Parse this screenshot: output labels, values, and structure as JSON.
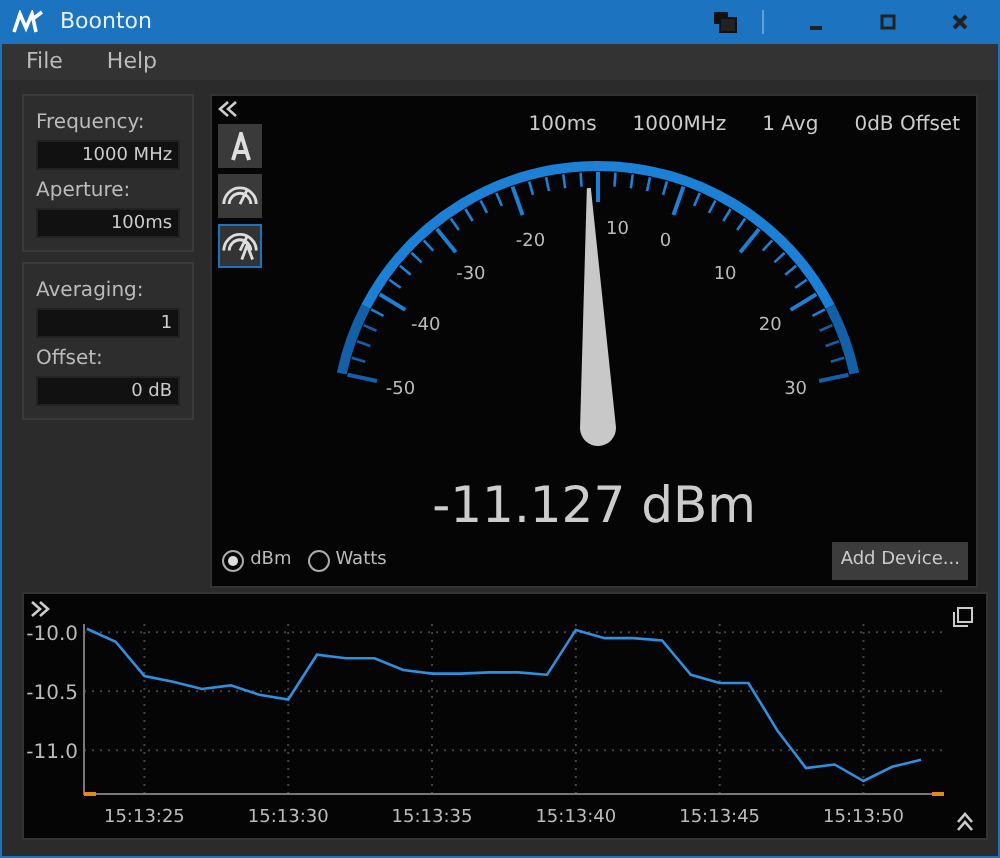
{
  "window": {
    "title": "Boonton"
  },
  "menu": [
    "File",
    "Help"
  ],
  "settings": [
    {
      "fields": [
        {
          "label": "Frequency:",
          "value": "1000 MHz"
        },
        {
          "label": "Aperture:",
          "value": "100ms"
        }
      ]
    },
    {
      "fields": [
        {
          "label": "Averaging:",
          "value": "1"
        },
        {
          "label": "Offset:",
          "value": "0 dB"
        }
      ]
    }
  ],
  "gauge": {
    "readouts": [
      "100ms",
      "1000MHz",
      "1 Avg",
      "0dB Offset"
    ],
    "view_buttons": [
      {
        "kind": "text",
        "selected": false
      },
      {
        "kind": "gauge",
        "selected": false
      },
      {
        "kind": "gauge_text",
        "selected": true
      }
    ],
    "scale_labels": [
      "-50",
      "-40",
      "-30",
      "-20",
      "10",
      "0",
      "10",
      "20",
      "30"
    ],
    "needle": {
      "level": 0.486
    },
    "reading": "-11.127 dBm",
    "units": [
      {
        "label": "dBm",
        "selected": true
      },
      {
        "label": "Watts",
        "selected": false
      }
    ],
    "add_button": "Add Device..."
  },
  "trend": {
    "chart_data": {
      "type": "line",
      "categories": [
        null,
        null,
        "15:13:25",
        null,
        null,
        null,
        null,
        "15:13:30",
        null,
        null,
        null,
        null,
        "15:13:35",
        null,
        null,
        null,
        null,
        "15:13:40",
        null,
        null,
        null,
        null,
        "15:13:45",
        null,
        null,
        null,
        null,
        "15:13:50",
        null,
        null
      ],
      "series": [
        {
          "color": "#2f8fe0",
          "values": [
            -9.97,
            -10.08,
            -10.37,
            -10.42,
            -10.48,
            -10.45,
            -10.53,
            -10.57,
            -10.19,
            -10.22,
            -10.22,
            -10.32,
            -10.35,
            -10.35,
            -10.34,
            -10.34,
            -10.36,
            -9.98,
            -10.05,
            -10.05,
            -10.07,
            -10.36,
            -10.43,
            -10.43,
            -10.83,
            -11.15,
            -11.12,
            -11.26,
            -11.14,
            -11.08
          ]
        }
      ],
      "ylim": [
        -11.37,
        -9.93
      ],
      "grid": true,
      "yticks": [
        {
          "value": -10,
          "label": "-10.0"
        },
        {
          "value": -10.5,
          "label": "-10.5"
        },
        {
          "value": -11,
          "label": "-11.0"
        }
      ]
    }
  }
}
